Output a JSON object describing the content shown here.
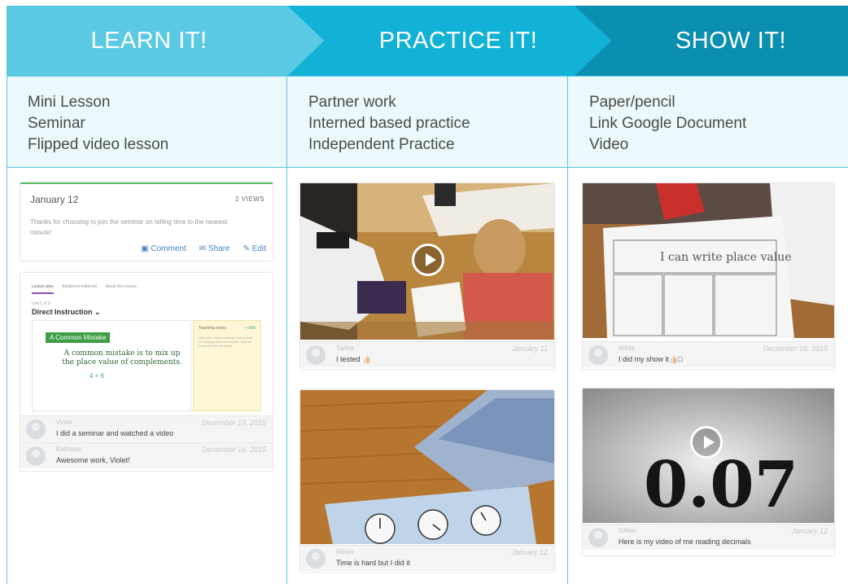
{
  "columns": [
    {
      "title": "LEARN IT!",
      "items": [
        "Mini Lesson",
        "Seminar",
        "Flipped video lesson"
      ]
    },
    {
      "title": "PRACTICE IT!",
      "items": [
        "Partner work",
        "Interned based practice",
        "Independent Practice"
      ]
    },
    {
      "title": "SHOW IT!",
      "items": [
        "Paper/pencil",
        "Link Google Document",
        "Video"
      ]
    }
  ],
  "colors": {
    "learn": "#5ac9e3",
    "practice": "#12b2d6",
    "show": "#0a8fb1",
    "row_bg": "#ecf9fc",
    "grid": "#5cc6e0"
  },
  "learn_post": {
    "date": "January 12",
    "views": "2 VIEWS",
    "body": "Thanks for choosing to join the seminar on telling time to the nearest minute!",
    "actions": [
      "Comment",
      "Share",
      "Edit"
    ]
  },
  "learn_lesson": {
    "tabs": [
      "Lesson plan",
      "Additional materials",
      "About this lesson"
    ],
    "unit": "Unit 1 of 3",
    "heading": "Direct Instruction ⌄",
    "mistake_label": "A Common Mistake",
    "mistake_text": "A common mistake is to mix up the place value of complements.",
    "math": "4 + 6",
    "teaching_notes_title": "Teaching notes",
    "teaching_notes_action": "+ Add",
    "teaching_notes_body": "Objective: show students how to read the analog clock and explain why we round the minute hand."
  },
  "comments": {
    "learn_1": {
      "name": "Violet",
      "text": "I did a seminar and watched a video",
      "date": "December 13, 2015"
    },
    "learn_2": {
      "name": "Kathleen",
      "text": "Awesome work, Violet!",
      "date": "December 16, 2015"
    },
    "practice_1": {
      "name": "Tanha",
      "text": "I tested 👍🏻",
      "date": "January 11"
    },
    "practice_2": {
      "name": "Mikah",
      "text": "Time is hard but I did it",
      "date": "January 12"
    },
    "show_1": {
      "name": "Wilda",
      "text": "I did my show it👍🏻□",
      "date": "December 16, 2015"
    },
    "show_2": {
      "name": "Gillian",
      "text": "Here is my video of me reading decimals",
      "date": "January 12"
    }
  },
  "show_video_text": "0.07",
  "icons": [
    "play-icon",
    "comment-icon",
    "share-icon",
    "edit-icon",
    "avatar-icon"
  ]
}
